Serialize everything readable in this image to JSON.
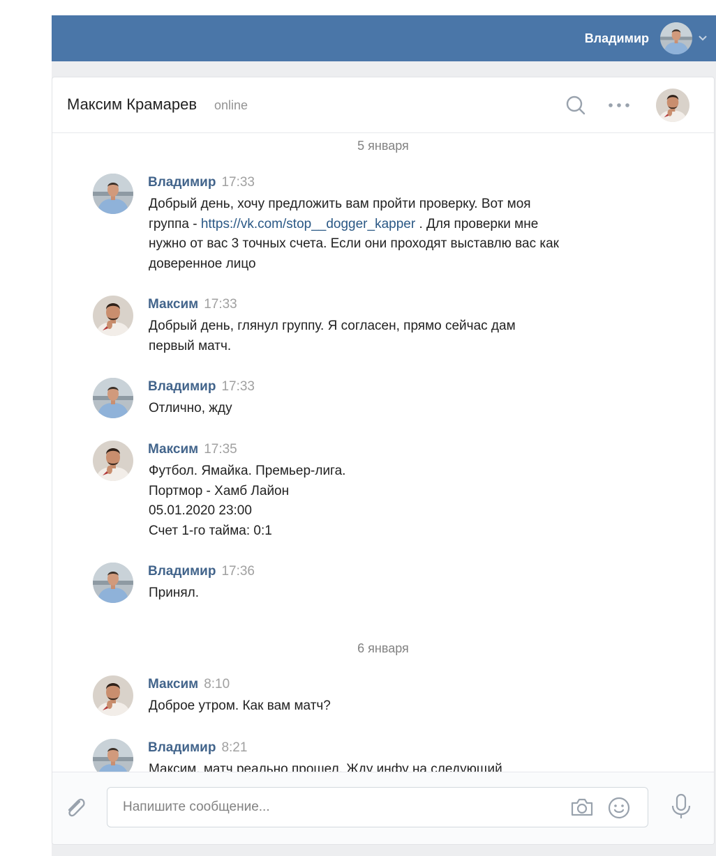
{
  "topbar": {
    "user_name": "Владимир"
  },
  "chat": {
    "title": "Максим Крамарев",
    "status": "online"
  },
  "history": {
    "dates": [
      "5 января",
      "6 января"
    ],
    "messages": [
      {
        "author": "Владимир",
        "time": "17:33",
        "lines": [
          "Добрый день, хочу предложить вам пройти проверку. Вот моя",
          "группа - ",
          "нужно от вас 3 точных счета. Если они проходят выставлю вас как",
          "доверенное лицо"
        ],
        "link": "https://vk.com/stop__dogger_kapper",
        "link_suffix": " . Для проверки мне"
      },
      {
        "author": "Максим",
        "time": "17:33",
        "lines": [
          "Добрый день, глянул группу. Я согласен, прямо сейчас дам",
          "первый матч."
        ]
      },
      {
        "author": "Владимир",
        "time": "17:33",
        "lines": [
          "Отлично, жду"
        ]
      },
      {
        "author": "Максим",
        "time": "17:35",
        "lines": [
          "Футбол. Ямайка. Премьер-лига.",
          "Портмор - Хамб Лайон",
          "05.01.2020 23:00",
          "Счет 1-го тайма: 0:1"
        ]
      },
      {
        "author": "Владимир",
        "time": "17:36",
        "lines": [
          "Принял."
        ]
      },
      {
        "author": "Максим",
        "time": "8:10",
        "lines": [
          "Доброе утром. Как вам матч?"
        ]
      },
      {
        "author": "Владимир",
        "time": "8:21",
        "lines": [
          "Максим, матч реально прошел. Жду инфу на следующий"
        ]
      }
    ]
  },
  "composer": {
    "placeholder": "Напишите сообщение..."
  },
  "colors": {
    "header_blue": "#4a76a8",
    "author_blue": "#42648b",
    "link_blue": "#2a5885"
  },
  "icons": [
    "chevron-down-icon",
    "search-icon",
    "more-icon",
    "paperclip-icon",
    "camera-icon",
    "emoji-icon",
    "microphone-icon"
  ]
}
